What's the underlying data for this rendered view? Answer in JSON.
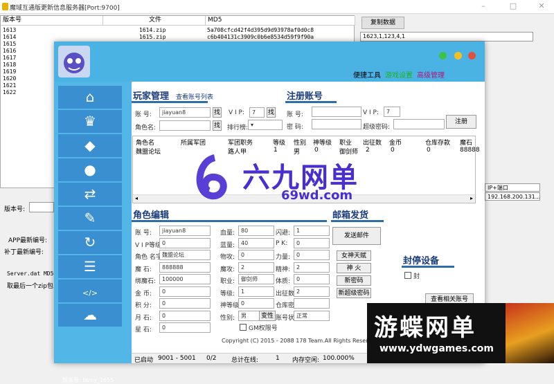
{
  "bg_window": {
    "title": "魔域互通版更新信息服务器[Port:9700]",
    "columns": [
      "版本号",
      "文件",
      "MD5"
    ],
    "rows": [
      {
        "ver": "1613",
        "file": "1614.zip",
        "md5": "5a708cfcd42f4d395d9d93978af0d0c8"
      },
      {
        "ver": "1614",
        "file": "1615.zip",
        "md5": "c6b404131c3909c0b6e8534d59f9f90a"
      },
      {
        "ver": "1615",
        "file": "",
        "md5": ""
      },
      {
        "ver": "1616",
        "file": "",
        "md5": ""
      },
      {
        "ver": "1617",
        "file": "",
        "md5": ""
      },
      {
        "ver": "1618",
        "file": "",
        "md5": ""
      },
      {
        "ver": "1619",
        "file": "",
        "md5": ""
      },
      {
        "ver": "1620",
        "file": "",
        "md5": ""
      },
      {
        "ver": "1621",
        "file": "",
        "md5": ""
      },
      {
        "ver": "1622",
        "file": "",
        "md5": ""
      }
    ],
    "copy_button": "复制数据",
    "copy_field": "1623,1,123,4,1",
    "version_label": "版本号:",
    "app_label": "APP最新编号:",
    "patch_label": "补丁最新编号:",
    "md5_note": "Server.dat MD5值",
    "zip_note": "取最后一个zip包",
    "port_header": "IP+端口",
    "ip_value": "192.168.200.131..."
  },
  "header": {
    "menu": [
      "便捷工具",
      "游戏设置",
      "高级管理"
    ]
  },
  "sidebar": {
    "icons": [
      "home-icon",
      "crown-icon",
      "diamond-icon",
      "egg-icon",
      "transfer-icon",
      "tag-icon",
      "refresh-icon",
      "list-icon",
      "code-icon",
      "cloud-icon"
    ],
    "version": "版本号: htmy_1655"
  },
  "player": {
    "title": "玩家管理",
    "view_link": "查看账号列表",
    "account_label": "账  号:",
    "account_value": "jiayuan8",
    "find": "找",
    "vip_label": "V I P:",
    "vip_value": "7",
    "role_label": "角色名:",
    "rank_label": "排行榜:",
    "table_headers": [
      "角色名",
      "所属军团",
      "军团职务",
      "等级",
      "性别",
      "神等级",
      "职业",
      "出征数",
      "金币",
      "仓库存款",
      "魔石"
    ],
    "table_row": [
      "魏盟论坛",
      "",
      "路人甲",
      "1",
      "男",
      "0",
      "御剑师",
      "2",
      "0",
      "0",
      "88888"
    ]
  },
  "register": {
    "title": "注册账号",
    "account_label": "账  号:",
    "vip_label": "V I P:",
    "vip_value": "7",
    "pwd_label": "密  码:",
    "super_label": "超级密码:",
    "button": "注册"
  },
  "role_edit": {
    "title": "角色编辑",
    "left": [
      {
        "l": "账  号:",
        "v": "jiayuan8"
      },
      {
        "l": "V I P等级:",
        "v": "0"
      },
      {
        "l": "角色 名字:",
        "v": "魏盟论坛"
      },
      {
        "l": "魔  石:",
        "v": "888888"
      },
      {
        "l": "绑魔石:",
        "v": "100000"
      },
      {
        "l": "金  币:",
        "v": "0"
      },
      {
        "l": "积  分:",
        "v": "0"
      },
      {
        "l": "月  石:",
        "v": "0"
      },
      {
        "l": "星  石:",
        "v": "0"
      }
    ],
    "mid": [
      {
        "l": "血量:",
        "v": "80"
      },
      {
        "l": "蓝量:",
        "v": "40"
      },
      {
        "l": "物攻:",
        "v": "0"
      },
      {
        "l": "魔攻:",
        "v": "2"
      },
      {
        "l": "职业:",
        "v": "御剑师"
      },
      {
        "l": "等级:",
        "v": "1"
      },
      {
        "l": "神等级:",
        "v": "0"
      },
      {
        "l": "性别:",
        "v": "男"
      }
    ],
    "right": [
      {
        "l": "闪避:",
        "v": "1"
      },
      {
        "l": "P  K:",
        "v": "0"
      },
      {
        "l": "力量:",
        "v": "0"
      },
      {
        "l": "精神:",
        "v": "2"
      },
      {
        "l": "体质:",
        "v": "0"
      },
      {
        "l": "出征数:",
        "v": "2"
      },
      {
        "l": "仓库密码:",
        "v": ""
      },
      {
        "l": "账号状态:",
        "v": "正常"
      }
    ],
    "transform": "变性",
    "gm_label": "GM权限号"
  },
  "mail": {
    "title": "邮箱发货",
    "send": "发送邮件",
    "buttons": [
      "女神天赋",
      "神  火",
      "新密码",
      "新超级密码"
    ]
  },
  "ban": {
    "title": "封停设备",
    "check_label": "封",
    "view_button": "查看相关账号"
  },
  "copyright": "Copyright (C) 2015 - 2088 178 Team.All Rights Reserved",
  "status": {
    "state": "已启动",
    "ports": "9001 - 5001",
    "count": "0/2",
    "online_label": "总计在线:",
    "online": "1",
    "mem_label": "内存空闲:",
    "mem": "100.000%"
  },
  "watermark": {
    "brand": "六九网单",
    "url": "69wd.com",
    "brand2": "游蝶网单",
    "url2": "www.ydwgames.com"
  },
  "colors": {
    "header": "#4bb3e4",
    "sidebar": "#52b6e6",
    "nav": "#3a8fd0",
    "title": "#1b3d7a"
  }
}
